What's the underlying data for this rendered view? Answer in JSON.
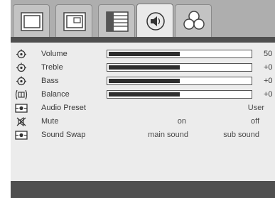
{
  "tabs": [
    {
      "icon": "picture-icon",
      "active": false
    },
    {
      "icon": "pip-icon",
      "active": false
    },
    {
      "icon": "setup-list-icon",
      "active": false
    },
    {
      "icon": "audio-icon",
      "active": true
    },
    {
      "icon": "options-icon",
      "active": false
    }
  ],
  "menu": {
    "volume": {
      "label": "Volume",
      "value": "50",
      "level": 0.5
    },
    "treble": {
      "label": "Treble",
      "value": "+0",
      "level": 0.5
    },
    "bass": {
      "label": "Bass",
      "value": "+0",
      "level": 0.5
    },
    "balance": {
      "label": "Balance",
      "value": "+0",
      "level": 0.5
    },
    "audio_preset": {
      "label": "Audio Preset",
      "value": "User"
    },
    "mute": {
      "label": "Mute",
      "option_1": "on",
      "option_2": "off"
    },
    "sound_swap": {
      "label": "Sound Swap",
      "option_1": "main sound",
      "option_2": "sub sound"
    }
  },
  "colors": {
    "tab_bar": "#aeaeae",
    "panel": "#ececec",
    "band": "#4f4f4f",
    "slider_fill": "#2e2e2e"
  }
}
